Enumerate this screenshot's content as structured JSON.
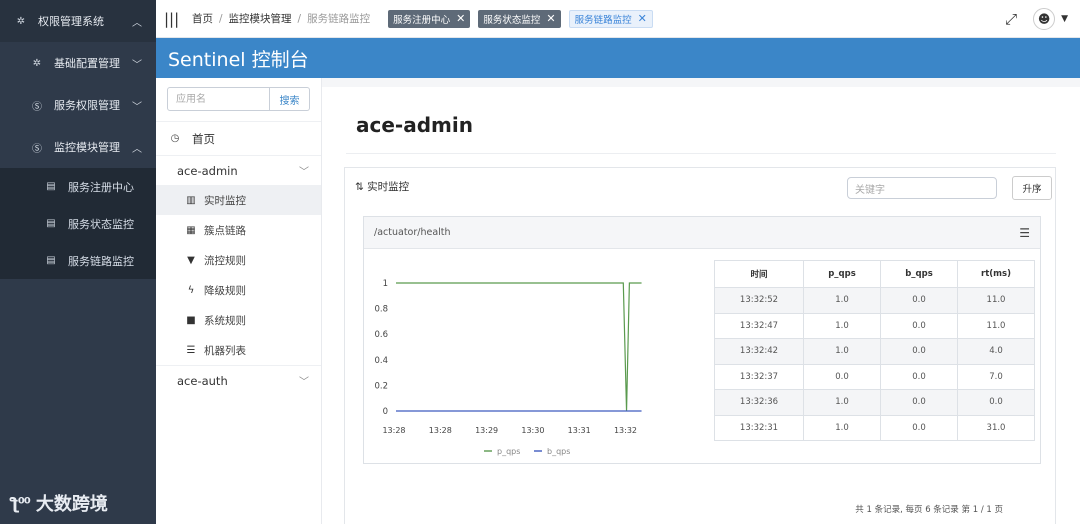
{
  "sidebar": {
    "head": {
      "label": "权限管理系统"
    },
    "items": [
      {
        "label": "基础配置管理"
      },
      {
        "label": "服务权限管理"
      },
      {
        "label": "监控模块管理"
      }
    ],
    "subitems": [
      {
        "label": "服务注册中心"
      },
      {
        "label": "服务状态监控"
      },
      {
        "label": "服务链路监控"
      }
    ],
    "watermark": "大数跨境"
  },
  "topbar": {
    "breadcrumb": [
      "首页",
      "监控模块管理",
      "服务链路监控"
    ],
    "tabs": [
      {
        "label": "服务注册中心",
        "active": false
      },
      {
        "label": "服务状态监控",
        "active": false
      },
      {
        "label": "服务链路监控",
        "active": true
      }
    ]
  },
  "sentinel": {
    "title": "Sentinel 控制台",
    "search_placeholder": "应用名",
    "search_button": "搜索",
    "home": "首页",
    "apps": [
      {
        "name": "ace-admin"
      },
      {
        "name": "ace-auth"
      }
    ],
    "menu": [
      "实时监控",
      "簇点链路",
      "流控规则",
      "降级规则",
      "系统规则",
      "机器列表"
    ]
  },
  "main": {
    "title": "ace-admin",
    "panel_title": "实时监控",
    "keyword_placeholder": "关键字",
    "sort_button": "升序",
    "resource": "/actuator/health",
    "pager": "共 1 条记录, 每页 6 条记录 第 1 / 1 页"
  },
  "table": {
    "headers": [
      "时间",
      "p_qps",
      "b_qps",
      "rt(ms)"
    ],
    "rows": [
      [
        "13:32:52",
        "1.0",
        "0.0",
        "11.0"
      ],
      [
        "13:32:47",
        "1.0",
        "0.0",
        "11.0"
      ],
      [
        "13:32:42",
        "1.0",
        "0.0",
        "4.0"
      ],
      [
        "13:32:37",
        "0.0",
        "0.0",
        "7.0"
      ],
      [
        "13:32:36",
        "1.0",
        "0.0",
        "0.0"
      ],
      [
        "13:32:31",
        "1.0",
        "0.0",
        "31.0"
      ]
    ]
  },
  "chart_data": {
    "type": "line",
    "x_ticks": [
      "13:28",
      "13:28",
      "13:29",
      "13:30",
      "13:31",
      "13:32"
    ],
    "y_ticks": [
      "0",
      "0.2",
      "0.4",
      "0.6",
      "0.8",
      "1"
    ],
    "ylim": [
      0,
      1
    ],
    "xlim": [
      0,
      6.8
    ],
    "series": [
      {
        "name": "p_qps",
        "color": "#5a9a4e",
        "x": [
          0,
          5.6,
          5.68,
          5.75,
          5.82,
          6.05
        ],
        "y": [
          1,
          1,
          0,
          1,
          1,
          1
        ]
      },
      {
        "name": "b_qps",
        "color": "#3f5bbf",
        "x": [
          0,
          6.05
        ],
        "y": [
          0,
          0
        ]
      }
    ],
    "legend": "bottom"
  },
  "colors": {
    "accent": "#3b86c8",
    "sidebar": "#2f3a4a"
  }
}
